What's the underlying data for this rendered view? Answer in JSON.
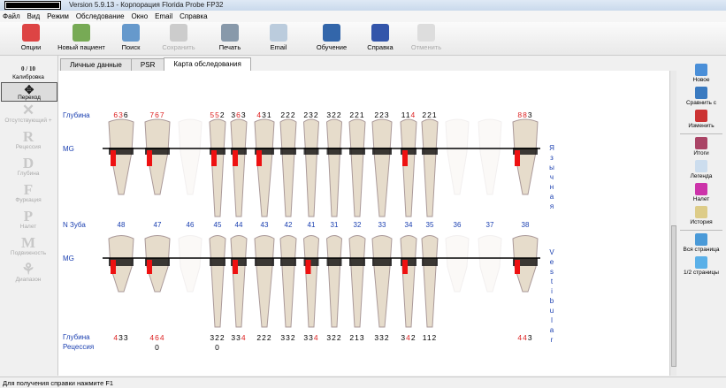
{
  "window": {
    "title": "Version 5.9.13 - Корпорация Florida Probe FP32"
  },
  "menu": [
    "Файл",
    "Вид",
    "Режим",
    "Обследование",
    "Окно",
    "Email",
    "Справка"
  ],
  "toolbar": [
    {
      "label": "Опции",
      "color": "#d44",
      "disabled": false
    },
    {
      "label": "Новый пациент",
      "color": "#7a5",
      "disabled": false
    },
    {
      "label": "Поиск",
      "color": "#69c",
      "disabled": false
    },
    {
      "label": "Сохранить",
      "color": "#ccc",
      "disabled": true
    },
    {
      "label": "Печать",
      "color": "#89a",
      "disabled": false
    },
    {
      "label": "Email",
      "color": "#bcd",
      "disabled": false
    },
    {
      "label": "Обучение",
      "color": "#36a",
      "disabled": false
    },
    {
      "label": "Справка",
      "color": "#35a",
      "disabled": false
    },
    {
      "label": "Отменить",
      "color": "#ddd",
      "disabled": true
    }
  ],
  "tabs": [
    {
      "label": "Личные данные",
      "active": false
    },
    {
      "label": "PSR",
      "active": false
    },
    {
      "label": "Карта обследования",
      "active": true
    }
  ],
  "left_tools": [
    {
      "glyph": "0 / 10",
      "label": "Калибровка",
      "enabled": true
    },
    {
      "glyph": "✥",
      "label": "Переход",
      "enabled": true,
      "selected": true
    },
    {
      "glyph": "✕",
      "label": "Отсутствующий +",
      "enabled": false
    },
    {
      "glyph": "R",
      "label": "Рецессия",
      "enabled": false
    },
    {
      "glyph": "D",
      "label": "Глубина",
      "enabled": false
    },
    {
      "glyph": "F",
      "label": "Фуркация",
      "enabled": false
    },
    {
      "glyph": "P",
      "label": "Налет",
      "enabled": false
    },
    {
      "glyph": "M",
      "label": "Подвижность",
      "enabled": false
    },
    {
      "glyph": "⚘",
      "label": "Диапазон",
      "enabled": false
    }
  ],
  "right_tools": [
    {
      "label": "Новое",
      "color": "#4a8fd8"
    },
    {
      "label": "Сравнить с",
      "color": "#3a7ac0"
    },
    {
      "label": "Изменить",
      "color": "#c33"
    },
    {
      "sep": true
    },
    {
      "label": "Итоги",
      "color": "#a46"
    },
    {
      "label": "Легенда",
      "color": "#cde"
    },
    {
      "label": "Налет",
      "color": "#c3a"
    },
    {
      "label": "История",
      "color": "#dc8"
    },
    {
      "sep": true
    },
    {
      "label": "Вся страница",
      "color": "#4a9ad8"
    },
    {
      "label": "1/2 страницы",
      "color": "#5ab0e8"
    }
  ],
  "chart": {
    "depth_label": "Глубина",
    "mg_label": "MG",
    "tooth_no_label": "N Зуба",
    "recession_label": "Рецессия",
    "lingual_label": "Язычная",
    "vestibular_label": "Vestibular",
    "upper_depths": [
      [
        "636",
        "01"
      ],
      [
        "767",
        "012"
      ],
      null,
      [
        "552",
        "01"
      ],
      [
        "363",
        "1"
      ],
      [
        "431",
        "0"
      ],
      [
        "222",
        ""
      ],
      [
        "232",
        ""
      ],
      [
        "322",
        ""
      ],
      [
        "221",
        ""
      ],
      [
        "223",
        ""
      ],
      [
        "114",
        "2"
      ],
      [
        "221",
        ""
      ],
      null,
      null,
      [
        "883",
        "01"
      ]
    ],
    "teeth": [
      "48",
      "47",
      "46",
      "45",
      "44",
      "43",
      "42",
      "41",
      "31",
      "32",
      "33",
      "34",
      "35",
      "36",
      "37",
      "38"
    ],
    "missing": [
      "46",
      "36",
      "37"
    ],
    "lower_depths": [
      [
        "433",
        "0"
      ],
      [
        "464",
        "012"
      ],
      null,
      [
        "322",
        ""
      ],
      [
        "334",
        "2"
      ],
      [
        "222",
        ""
      ],
      [
        "332",
        ""
      ],
      [
        "334",
        "2"
      ],
      [
        "322",
        ""
      ],
      [
        "213",
        ""
      ],
      [
        "332",
        ""
      ],
      [
        "342",
        "1"
      ],
      [
        "112",
        ""
      ],
      null,
      null,
      [
        "443",
        "01"
      ]
    ],
    "recession": [
      null,
      "0",
      null,
      "0",
      null,
      null,
      null,
      null,
      null,
      null,
      null,
      null,
      null,
      null,
      null,
      null
    ]
  },
  "status": "Для получения справки нажмите F1"
}
